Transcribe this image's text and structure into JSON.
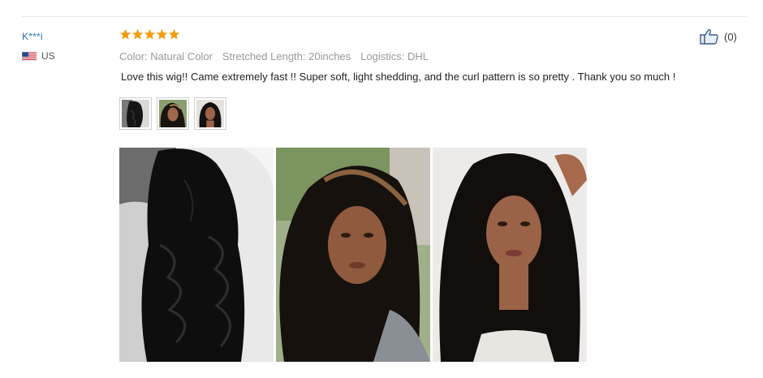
{
  "reviewer": {
    "name": "K***i",
    "country": "US",
    "flag_icon": "us-flag-icon"
  },
  "rating": {
    "stars": 5,
    "max": 5,
    "star_color": "#f39c12"
  },
  "like": {
    "icon": "thumbs-up-icon",
    "count": "(0)"
  },
  "meta": {
    "color": "Color: Natural Color",
    "stretched_length": "Stretched Length: 20inches",
    "logistics": "Logistics: DHL"
  },
  "review_text": "Love this wig!! Came extremely fast !! Super soft, light shedding, and the curl pattern is so pretty . Thank you so much !",
  "thumbnails": [
    "wig-thumbnail-1",
    "wig-thumbnail-2",
    "wig-thumbnail-3"
  ],
  "photos": [
    "wig-photo-1",
    "wig-photo-2",
    "wig-photo-3"
  ],
  "colors": {
    "name_blue": "#2a6fb0",
    "meta_gray": "#999999",
    "divider": "#e8e8e8"
  }
}
